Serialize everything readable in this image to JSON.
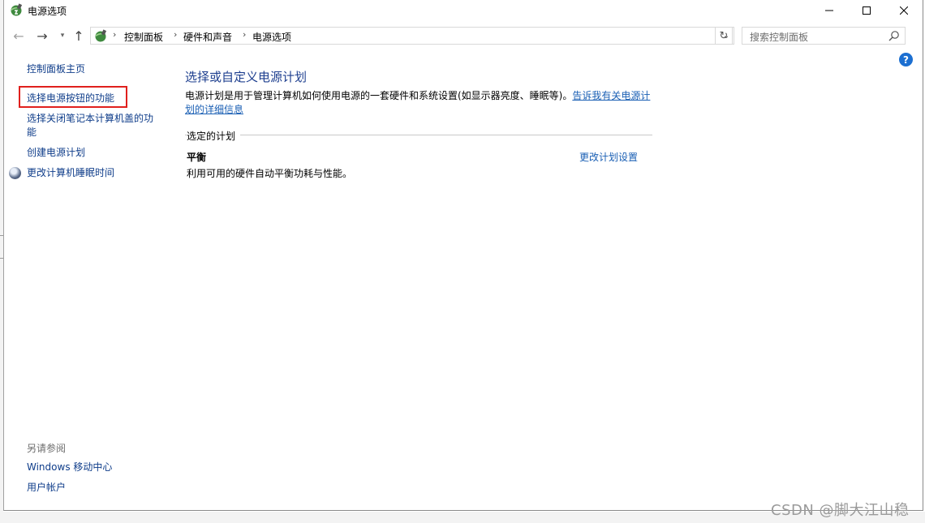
{
  "window": {
    "title": "电源选项"
  },
  "nav": {
    "breadcrumbs": [
      "控制面板",
      "硬件和声音",
      "电源选项"
    ],
    "search_placeholder": "搜索控制面板"
  },
  "left": {
    "home": "控制面板主页",
    "power_button": "选择电源按钮的功能",
    "lid": "选择关闭笔记本计算机盖的功能",
    "create_plan": "创建电源计划",
    "sleep": "更改计算机睡眠时间",
    "see_also": "另请参阅",
    "mobility": "Windows 移动中心",
    "accounts": "用户帐户"
  },
  "main": {
    "title": "选择或自定义电源计划",
    "description": "电源计划是用于管理计算机如何使用电源的一套硬件和系统设置(如显示器亮度、睡眠等)。",
    "description_link": "告诉我有关电源计划的详细信息",
    "section_label": "选定的计划",
    "plan_name": "平衡",
    "plan_desc": "利用可用的硬件自动平衡功耗与性能。",
    "plan_change": "更改计划设置"
  },
  "watermark": "CSDN @脚大江山稳",
  "colors": {
    "link": "#0f3d8a",
    "accent_link": "#1a5fb4",
    "highlight": "#e0201d"
  }
}
